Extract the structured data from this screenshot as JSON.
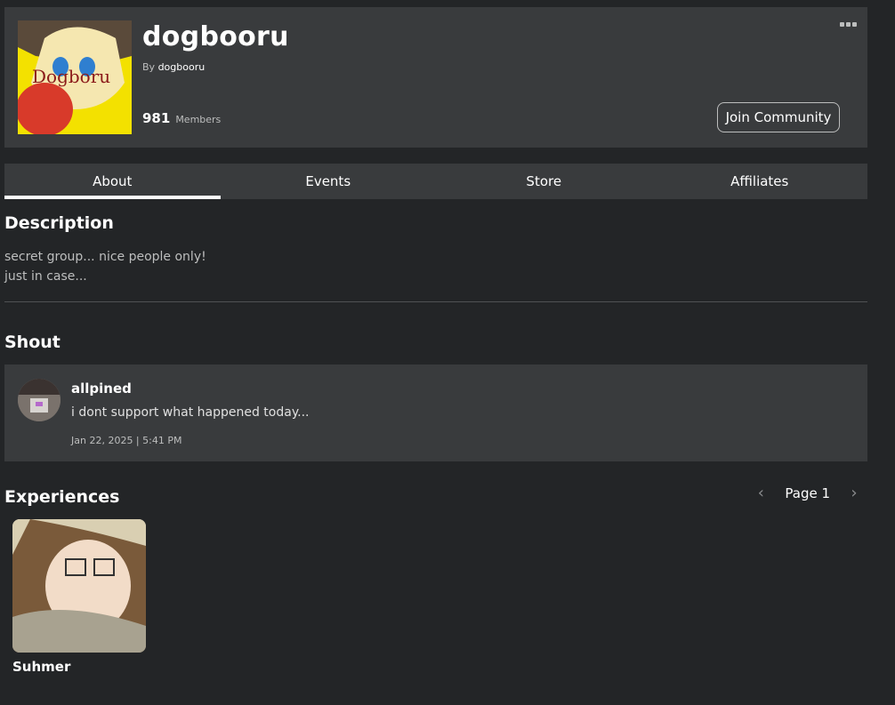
{
  "header": {
    "title": "dogbooru",
    "by_prefix": "By",
    "owner": "dogbooru",
    "member_count": "981",
    "member_label": "Members",
    "join_label": "Join Community"
  },
  "tabs": [
    {
      "label": "About",
      "active": true
    },
    {
      "label": "Events"
    },
    {
      "label": "Store"
    },
    {
      "label": "Affiliates"
    }
  ],
  "about": {
    "description_heading": "Description",
    "description_lines": [
      "secret group... nice people only!",
      "just in case..."
    ]
  },
  "shout": {
    "heading": "Shout",
    "username": "allpined",
    "message": "i dont support what happened today...",
    "timestamp": "Jan 22, 2025 | 5:41 PM"
  },
  "experiences": {
    "heading": "Experiences",
    "page_label": "Page 1",
    "items": [
      {
        "name": "Suhmer"
      }
    ]
  },
  "icons": {
    "more": "more-options-icon",
    "prev": "chevron-left-icon",
    "next": "chevron-right-icon"
  }
}
